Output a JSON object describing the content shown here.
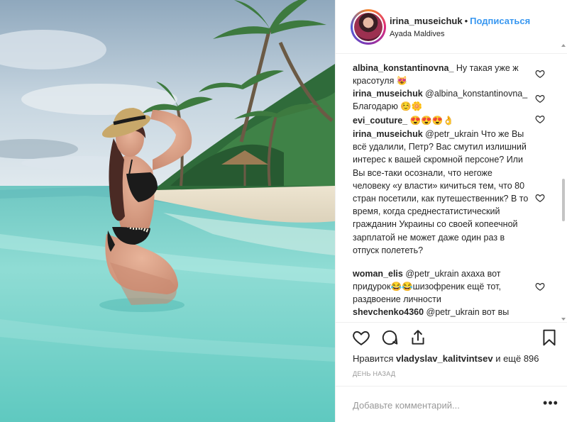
{
  "header": {
    "username": "irina_museichuk",
    "separator": "•",
    "follow_label": "Подписаться",
    "location": "Ayada Maldives"
  },
  "comments": [
    {
      "user": "albina_konstantinovna_",
      "text": " Ну такая уже ж красотуля 😻"
    },
    {
      "user": "irina_museichuk",
      "text": " @albina_konstantinovna_ Благодарю ☺️🌼"
    },
    {
      "user": "evi_couture_",
      "text": " 😍😍😍👌"
    },
    {
      "user": "irina_museichuk",
      "text": " @petr_ukrain Что же Вы всё удалили, Петр? Вас смутил излишний интерес к вашей скромной персоне? Или Вы все-таки осознали, что негоже человеку «у власти» кичиться тем, что 80 стран посетили, как путешественник? В то время, когда среднестатистический гражданин Украины со своей копеечной зарплатой не может даже один раз в отпуск полететь?"
    },
    {
      "user": "woman_elis",
      "text": " @petr_ukrain ахаха вот придурок😂😂шизофреник ещё тот, раздвоение личности"
    },
    {
      "user": "shevchenko4360",
      "text": " @petr_ukrain вот вы нарочно что ли"
    }
  ],
  "actions": {
    "like_icon": "heart-icon",
    "comment_icon": "comment-icon",
    "share_icon": "share-icon",
    "save_icon": "bookmark-icon"
  },
  "likes": {
    "prefix": "Нравится ",
    "user": "vladyslav_kalitvintsev",
    "suffix": " и ещё 896"
  },
  "date": "ДЕНЬ НАЗАД",
  "add_comment": {
    "placeholder": "Добавьте комментарий...",
    "more_label": "•••"
  },
  "colors": {
    "accent": "#3897f0",
    "text": "#262626",
    "muted": "#999999",
    "border": "#efefef"
  }
}
